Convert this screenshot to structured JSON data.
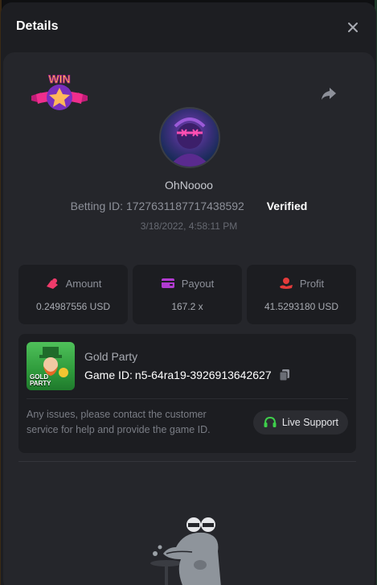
{
  "header": {
    "title": "Details"
  },
  "player": {
    "username": "OhNoooo",
    "betting_label": "Betting ID:",
    "betting_id": "1727631187717438592",
    "verified": "Verified",
    "datetime": "3/18/2022, 4:58:11 PM"
  },
  "badge": {
    "text": "WIN"
  },
  "stats": [
    {
      "label": "Amount",
      "value": "0.24987556 USD",
      "icon": "amount-icon",
      "color": "#ef3b6b"
    },
    {
      "label": "Payout",
      "value": "167.2 x",
      "icon": "wallet-icon",
      "color": "#b13bd0"
    },
    {
      "label": "Profit",
      "value": "41.5293180 USD",
      "icon": "profit-icon",
      "color": "#e43b3b"
    }
  ],
  "game": {
    "name": "Gold Party",
    "id_label": "Game ID:",
    "id_value": "n5-64ra19-3926913642627",
    "thumb_text": "GOLD\nPARTY",
    "help_text": "Any issues, please contact the customer service for help and provide the game ID.",
    "support_label": "Live Support",
    "support_color": "#3ecf4b"
  }
}
